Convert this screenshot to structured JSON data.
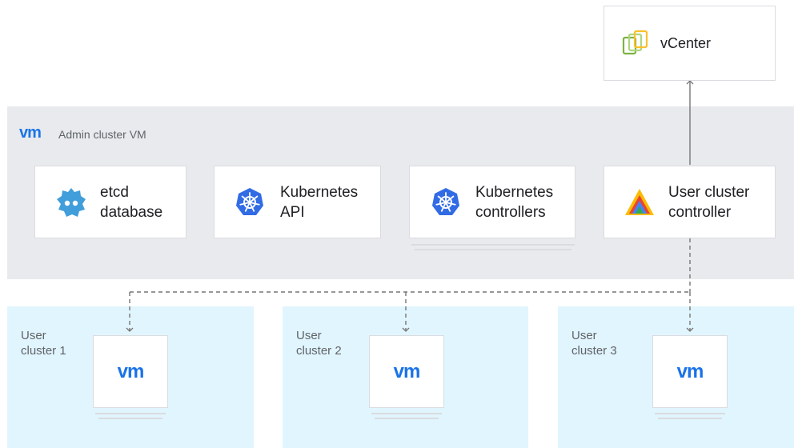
{
  "vcenter": {
    "label": "vCenter",
    "icon": "vsphere-icon"
  },
  "admin_cluster": {
    "brand": "vm",
    "label": "Admin cluster VM",
    "components": [
      {
        "label_line1": "etcd",
        "label_line2": "database",
        "icon": "etcd-icon"
      },
      {
        "label_line1": "Kubernetes",
        "label_line2": "API",
        "icon": "kubernetes-icon"
      },
      {
        "label_line1": "Kubernetes",
        "label_line2": "controllers",
        "icon": "kubernetes-icon"
      },
      {
        "label_line1": "User cluster",
        "label_line2": "controller",
        "icon": "anthos-icon"
      }
    ]
  },
  "user_clusters": [
    {
      "label_line1": "User",
      "label_line2": "cluster 1",
      "vm": "vm"
    },
    {
      "label_line1": "User",
      "label_line2": "cluster 2",
      "vm": "vm"
    },
    {
      "label_line1": "User",
      "label_line2": "cluster 3",
      "vm": "vm"
    }
  ],
  "colors": {
    "admin_band": "#e8eaed",
    "user_band": "#e1f5fe",
    "vm_blue": "#1a73e8",
    "k8s_blue": "#326ce5",
    "etcd_blue": "#419eda",
    "connector": "#757575"
  }
}
